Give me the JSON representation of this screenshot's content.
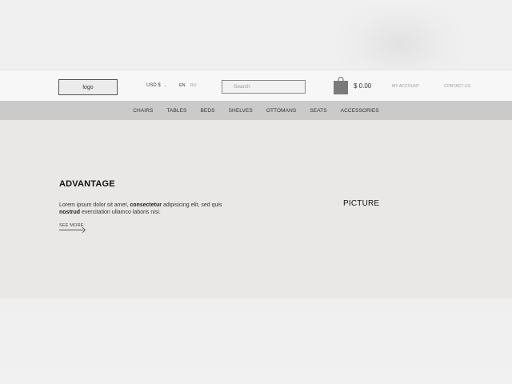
{
  "header": {
    "logo_text": "logo",
    "currency": "USD $",
    "currency_caret": "⌄",
    "languages": [
      "EN",
      "RU"
    ],
    "search_placeholder": "Search",
    "cart_total": "$ 0.00",
    "my_account": "MY ACCOUNT",
    "contact_us": "CONTACT US"
  },
  "nav": {
    "items": [
      "CHAIRS",
      "TABLES",
      "BEDS",
      "SHELVES",
      "OTTOMANS",
      "SEATS",
      "ACCESSORIES"
    ]
  },
  "hero": {
    "title": "ADVANTAGE",
    "text_part1": "Lorem ipsum dolor sit amet, ",
    "text_bold1": "consectetur",
    "text_part2": " adipisicing elit, sed quis ",
    "text_bold2": "nostrud",
    "text_part3": " exercitation ullamco laboris nisi.",
    "see_more": "SEE MORE",
    "picture_label": "PICTURE"
  },
  "colors": {
    "nav_bg": "#cacaca",
    "hero_bg": "#eae7e7",
    "header_bg": "#f7f7f7",
    "cart_icon": "#7a7a7a"
  },
  "icons": {
    "cart": "shopping-bag-icon",
    "currency_caret": "chevron-down-icon",
    "see_more_arrow": "arrow-right-icon"
  }
}
